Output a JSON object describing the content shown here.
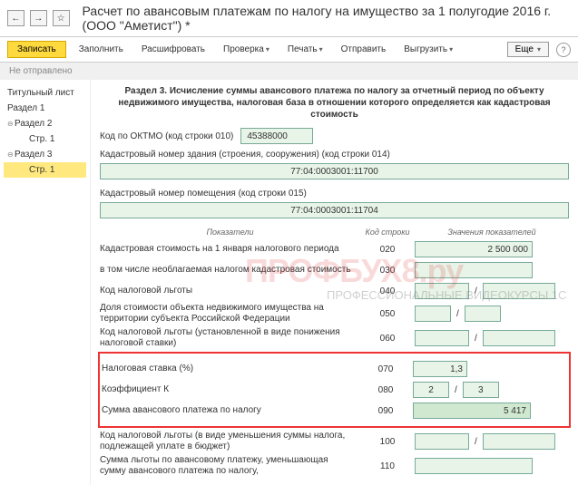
{
  "header": {
    "title": "Расчет по авансовым платежам по налогу на имущество за 1 полугодие 2016 г. (ООО \"Аметист\") *"
  },
  "toolbar": {
    "save": "Записать",
    "fill": "Заполнить",
    "decode": "Расшифровать",
    "check": "Проверка",
    "print": "Печать",
    "send": "Отправить",
    "upload": "Выгрузить",
    "more": "Еще"
  },
  "status": "Не отправлено",
  "sidebar": {
    "items": [
      {
        "label": "Титульный лист"
      },
      {
        "label": "Раздел 1"
      },
      {
        "label": "Раздел 2"
      },
      {
        "label": "Стр. 1"
      },
      {
        "label": "Раздел 3"
      },
      {
        "label": "Стр. 1"
      }
    ]
  },
  "section": {
    "title": "Раздел 3. Исчисление суммы авансового платежа по налогу за отчетный период по объекту недвижимого имущества, налоговая база в отношении которого определяется как кадастровая стоимость",
    "oktmo_label": "Код по ОКТМО (код строки 010)",
    "oktmo_value": "45388000",
    "kad_building_label": "Кадастровый номер здания (строения, сооружения) (код строки 014)",
    "kad_building_value": "77:04:0003001:11700",
    "kad_room_label": "Кадастровый номер помещения (код строки 015)",
    "kad_room_value": "77:04:0003001:11704"
  },
  "table_head": {
    "c1": "Показатели",
    "c2": "Код строки",
    "c3": "Значения показателей"
  },
  "rows": {
    "r020": {
      "label": "Кадастровая стоимость на 1 января налогового периода",
      "code": "020",
      "value": "2 500 000"
    },
    "r030": {
      "label": "в том числе необлагаемая налогом кадастровая стоимость",
      "code": "030",
      "value": ""
    },
    "r040": {
      "label": "Код налоговой льготы",
      "code": "040",
      "v1": "",
      "v2": ""
    },
    "r050": {
      "label": "Доля стоимости объекта недвижимого имущества на территории субъекта Российской Федерации",
      "code": "050",
      "v1": "",
      "v2": ""
    },
    "r060": {
      "label": "Код налоговой льготы (установленной в виде понижения налоговой ставки)",
      "code": "060",
      "v1": "",
      "v2": ""
    },
    "r070": {
      "label": "Налоговая ставка (%)",
      "code": "070",
      "value": "1,3"
    },
    "r080": {
      "label": "Коэффициент К",
      "code": "080",
      "v1": "2",
      "v2": "3"
    },
    "r090": {
      "label": "Сумма авансового платежа по налогу",
      "code": "090",
      "value": "5 417"
    },
    "r100": {
      "label": "Код налоговой льготы (в виде уменьшения суммы налога, подлежащей уплате в бюджет)",
      "code": "100",
      "v1": "",
      "v2": ""
    },
    "r110": {
      "label": "Сумма льготы по авансовому платежу, уменьшающая сумму авансового платежа по налогу,",
      "code": "110",
      "value": ""
    }
  },
  "watermark": {
    "big": "ПРОФБУХ8.ру",
    "small": "ПРОФЕССИОНАЛЬНЫЕ ВИДЕОКУРСЫ 1С"
  }
}
